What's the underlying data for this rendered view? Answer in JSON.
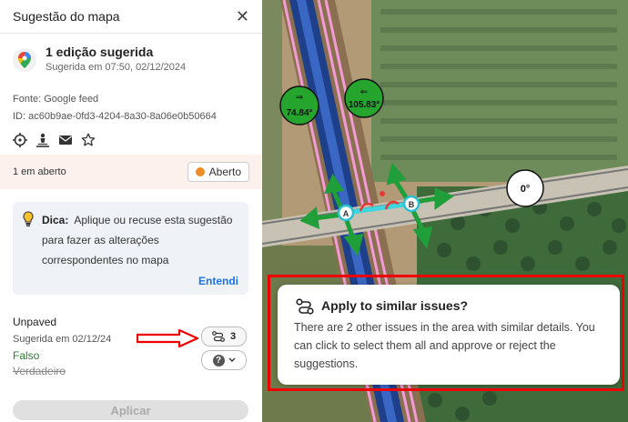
{
  "panel": {
    "title": "Sugestão do mapa",
    "close_symbol": "✕",
    "edit_title": "1 edição sugerida",
    "edit_subtitle": "Sugerida em 07:50, 02/12/2024",
    "source": "Fonte: Google feed",
    "id": "ID: ac60b9ae-0fd3-4204-8a30-8a06e0b50664",
    "action_icons": [
      "crosshair-icon",
      "person-pin-icon",
      "mail-icon",
      "star-icon"
    ],
    "status_text": "1 em aberto",
    "status_button": "Aberto",
    "tip_prefix": "Dica:",
    "tip_text": "Aplique ou recuse esta sugestão para fazer as alterações correspondentes no mapa",
    "tip_action": "Entendi",
    "field_label": "Unpaved",
    "field_sub": "Sugerida em 02/12/24",
    "value_new": "Falso",
    "value_old": "Verdadeiro",
    "similar_count": "3",
    "apply_label": "Aplicar"
  },
  "map": {
    "label_left_arrow": "⇒",
    "label_left_angle": "74.84°",
    "label_right_arrow": "⇐",
    "label_right_angle": "105.83°",
    "label_zero": "0°",
    "node_a": "A",
    "node_b": "B"
  },
  "popup": {
    "title": "Apply to similar issues?",
    "body": "There are 2 other issues in the area with similar details. You can click to select them all and approve or reject the suggestions."
  },
  "colors": {
    "accent_blue": "#1a73e8",
    "status_bg": "#fdf1ee",
    "annotation_red": "#e00000",
    "success_green": "#2e7d32"
  }
}
